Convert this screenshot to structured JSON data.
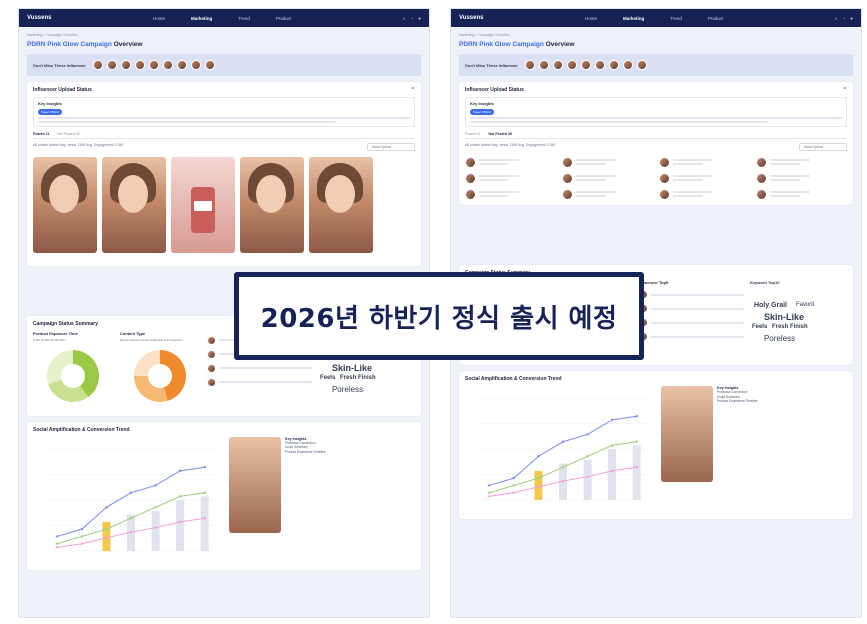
{
  "banner": {
    "text": "2026년 하반기 정식 출시 예정"
  },
  "topbar": {
    "logo": "Vussens",
    "nav": [
      "Home",
      "Marketing",
      "Trend",
      "Product"
    ],
    "icons": [
      "search-icon",
      "bell-icon",
      "user-icon"
    ]
  },
  "page": {
    "breadcrumb": "Marketing > Campaign Overview",
    "title_link": "PDRN Pink Glow Campaign",
    "title_rest": "Overview",
    "dont_miss": "Don't Miss These Influencer"
  },
  "upload": {
    "title": "Influencer Upload Status",
    "insights_title": "Key Insights",
    "chip": "Tweet TB(13)",
    "tabs": [
      "Posted 11",
      "Not Posted 39"
    ],
    "filter_text": "All posted status Avg. views 130K  Avg. Engagement 3,340",
    "sort_label": "Most Option"
  },
  "summary": {
    "title": "Campaign Status Summary",
    "exposure_title": "Product Exposure Time",
    "content_title": "Content Type",
    "top5_title": "Influencer Top5",
    "keyword_title": "Keyword Top10",
    "exposure_legend": "0-15s  15-30s  30-60s  60s+",
    "content_legend": "Review  Routine  Tutorial  Swatching  Full Impression",
    "keywords": [
      "Holy Grail",
      "Favorit",
      "Skin-Like",
      "Feels",
      "Fresh Finish",
      "Poreless",
      "Glowy"
    ]
  },
  "trend": {
    "title": "Social Amplification & Conversion Trend",
    "legend": [
      "Seeding Content",
      "Views",
      "Engagement",
      "Commerce Review Count"
    ],
    "side_title": "Key Insights",
    "side_labels": [
      "Purchase Conversion",
      "Script Summary",
      "Product Experience Timeline"
    ],
    "influencer_label": "Influencer"
  },
  "chart_data": {
    "type": "line",
    "x": [
      "W1",
      "W2",
      "W3",
      "W4",
      "W5",
      "W6",
      "W7"
    ],
    "series": [
      {
        "name": "Views",
        "values": [
          2,
          3,
          6,
          8,
          9,
          11,
          11.5
        ]
      },
      {
        "name": "Engagement",
        "values": [
          1,
          2,
          3,
          4.5,
          6,
          7.5,
          8
        ]
      },
      {
        "name": "Commerce Review Count",
        "values": [
          0.5,
          1,
          1.8,
          2.6,
          3.2,
          4,
          4.5
        ]
      }
    ],
    "bars": [
      0,
      0,
      4,
      5,
      5.5,
      7,
      7.5
    ]
  }
}
